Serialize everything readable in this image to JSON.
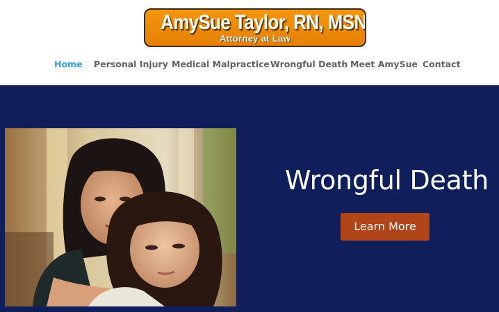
{
  "header": {
    "logo_title": "AmySue Taylor, RN, MSN, JD",
    "logo_subtitle": "Attorney at Law",
    "colors": {
      "logo_bg": "#f08a0a",
      "active_nav": "#2ea3f2"
    }
  },
  "nav": {
    "items": [
      {
        "label": "Home",
        "active": true
      },
      {
        "label": "Personal Injury",
        "active": false
      },
      {
        "label": "Medical Malpractice",
        "active": false
      },
      {
        "label": "Wrongful Death",
        "active": false
      },
      {
        "label": "Meet AmySue",
        "active": false
      },
      {
        "label": "Contact",
        "active": false
      }
    ]
  },
  "hero": {
    "title": "Wrongful Death",
    "button_label": "Learn More",
    "colors": {
      "background": "#101f5b",
      "button": "#b0451a"
    }
  }
}
